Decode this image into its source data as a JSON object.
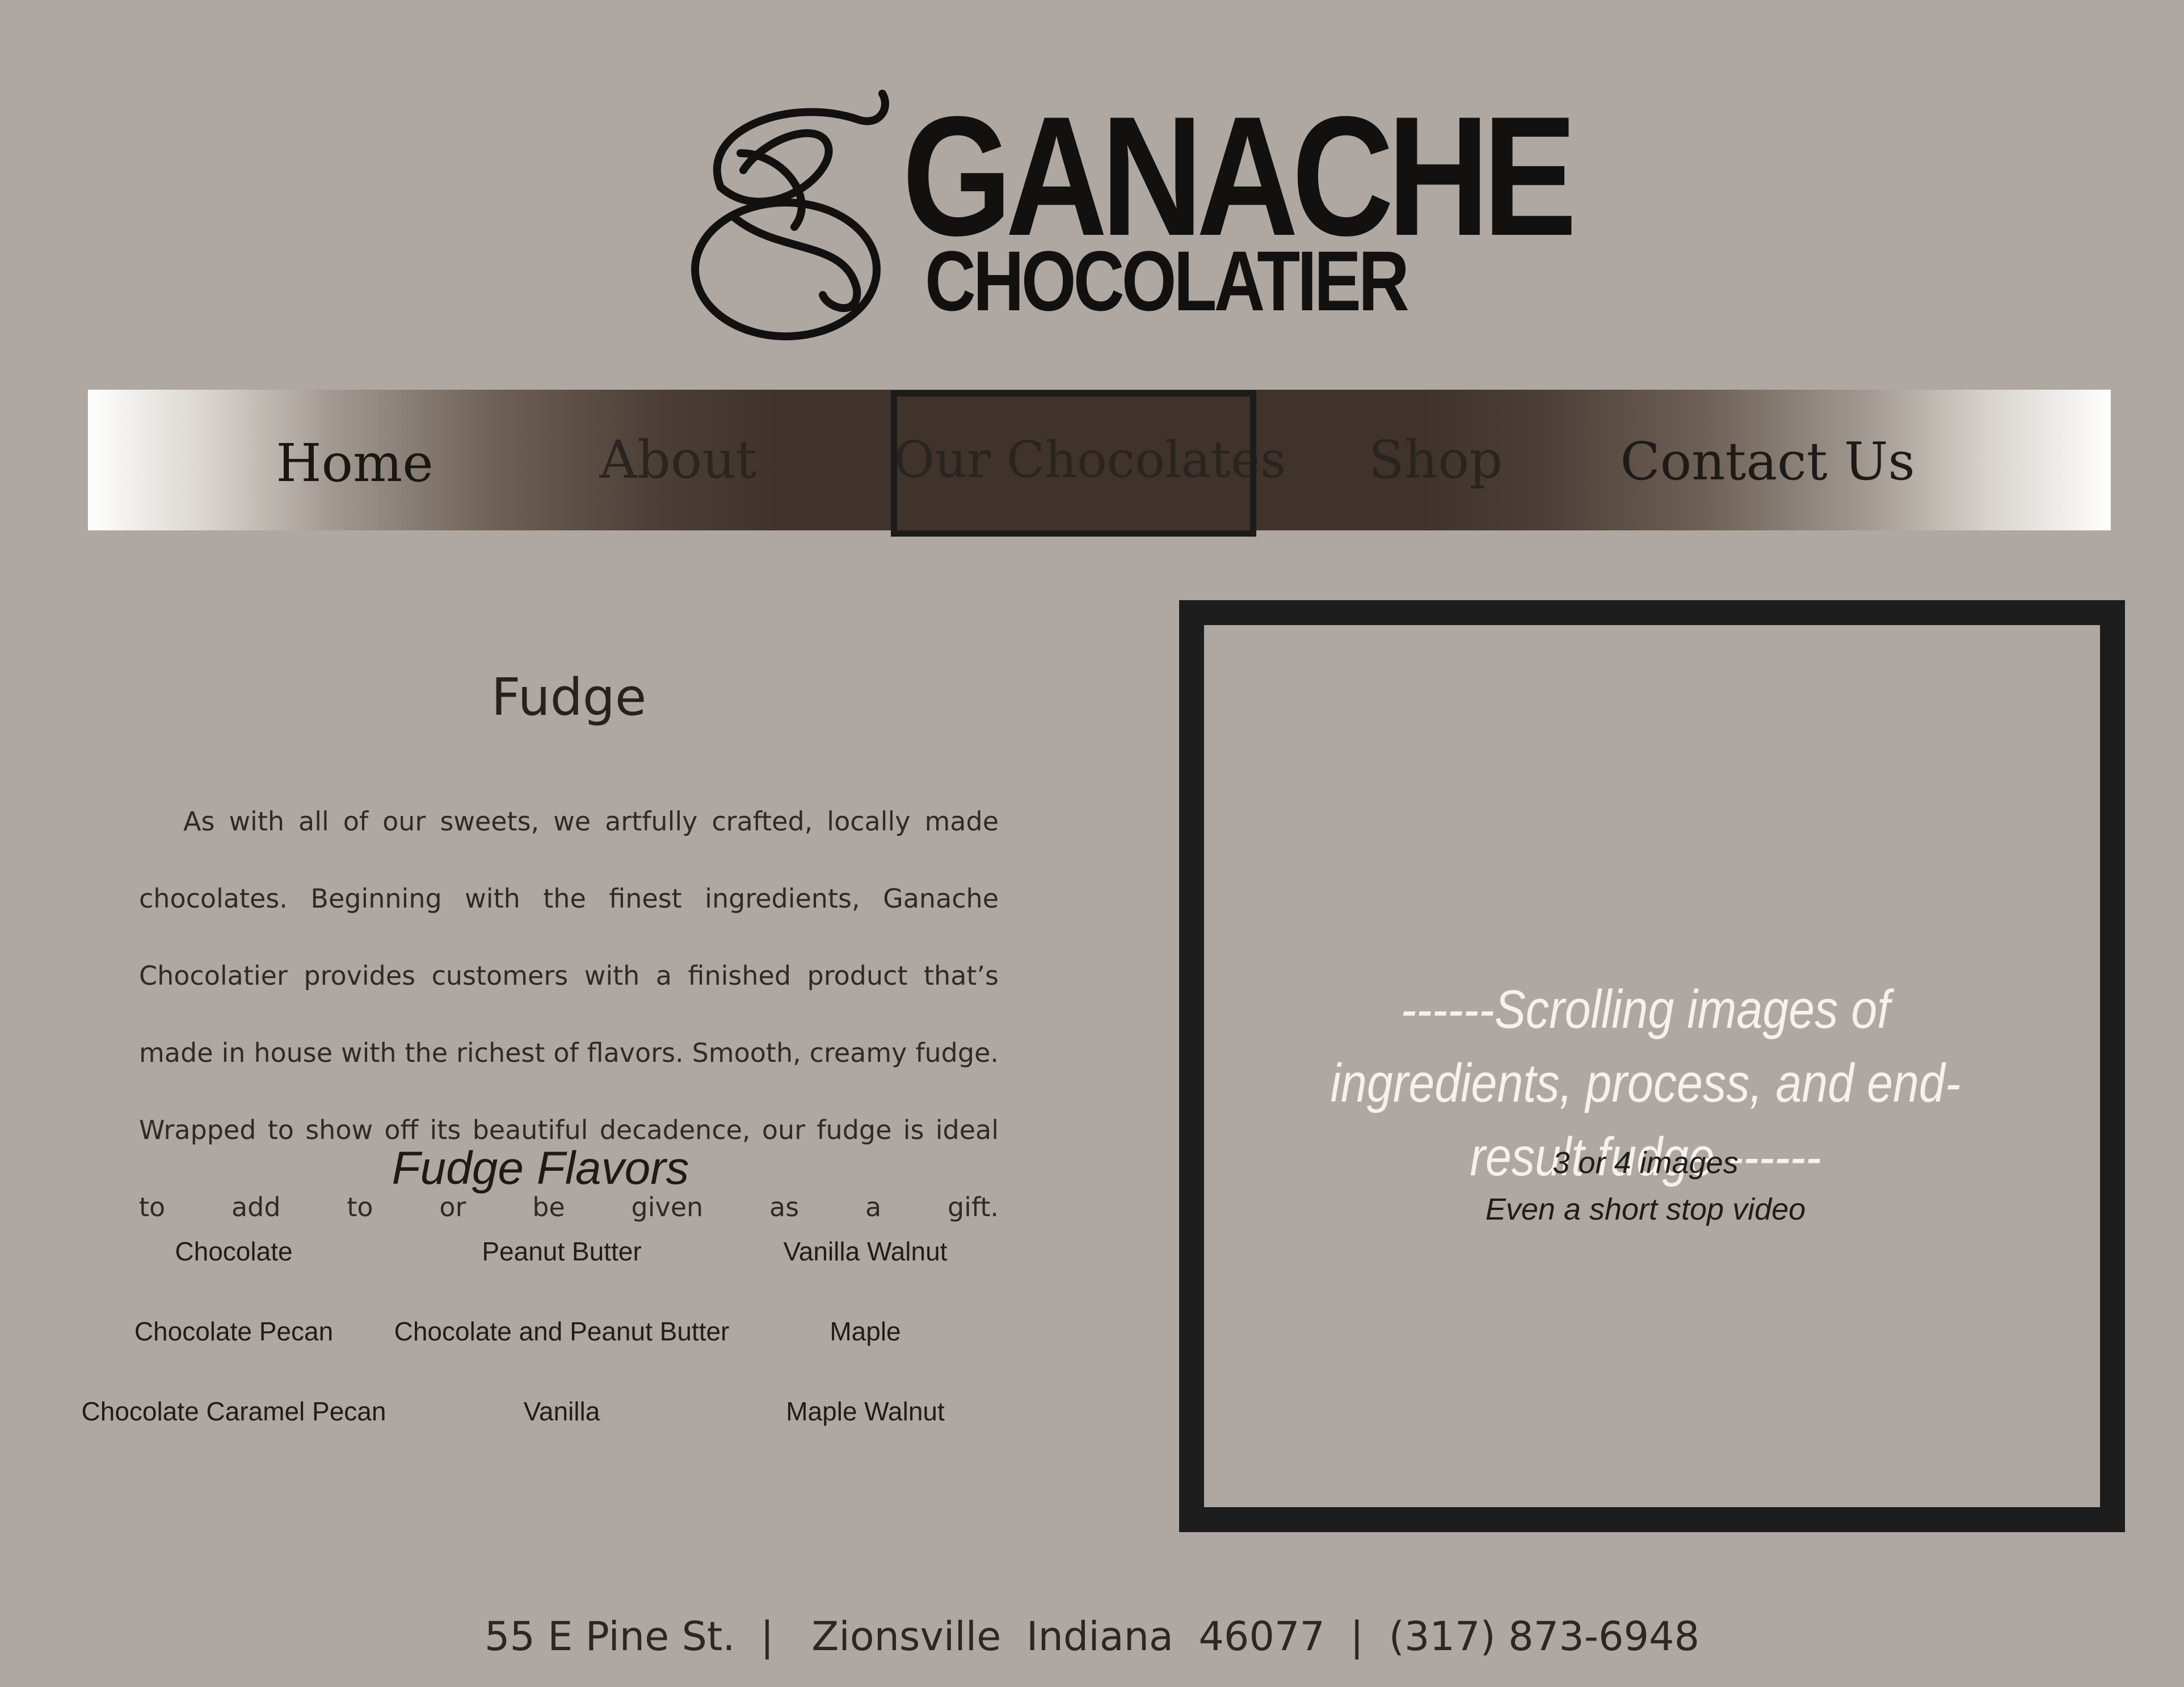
{
  "logo": {
    "name": "GANACHE",
    "tagline": "CHOCOLATIER"
  },
  "nav": {
    "items": [
      {
        "label": "Home"
      },
      {
        "label": "About"
      },
      {
        "label": "Our Chocolates",
        "active": true
      },
      {
        "label": "Shop"
      },
      {
        "label": "Contact Us"
      }
    ]
  },
  "content": {
    "heading": "Fudge",
    "paragraph": "As with all of our sweets, we artfully crafted, locally made chocolates. Beginning with the finest ingredients, Ganache Chocolatier provides customers with a finished product that’s made in house with the richest of flavors.   Smooth, creamy fudge. Wrapped to show off its beautiful decadence,  our fudge is ideal to add to or be given as a gift.",
    "flavors_title": "Fudge Flavors",
    "flavors": [
      "Chocolate",
      "Peanut Butter",
      "Vanilla Walnut",
      "Chocolate Pecan",
      "Chocolate and Peanut Butter",
      "Maple",
      "Chocolate Caramel Pecan",
      "Vanilla",
      "Maple Walnut"
    ]
  },
  "media": {
    "caption": "------Scrolling images of ingredients, process, and end-result fudge ------",
    "note_1": "3 or 4 images",
    "note_2": "Even a short stop video"
  },
  "footer": {
    "address": "55 E Pine St.  |   Zionsville  Indiana  46077  |  (317) 873-6948"
  },
  "colors": {
    "background": "#afa8a2",
    "nav_dark": "#3f332c",
    "frame": "#1e1d1d",
    "text": "#2a2624"
  }
}
